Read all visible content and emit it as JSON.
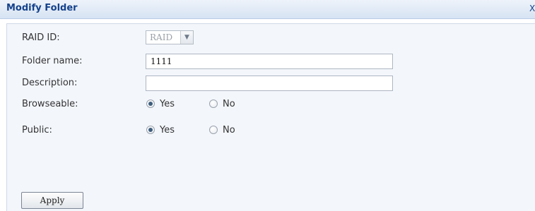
{
  "window": {
    "title": "Modify Folder",
    "close_glyph": "X"
  },
  "form": {
    "raid_id": {
      "label": "RAID ID:",
      "value": "RAID",
      "arrow_icon": "chevron-down-icon",
      "disabled": true
    },
    "folder_name": {
      "label": "Folder name:",
      "value": "1111"
    },
    "description": {
      "label": "Description:",
      "value": ""
    },
    "browseable": {
      "label": "Browseable:",
      "options": [
        "Yes",
        "No"
      ],
      "selected": "Yes"
    },
    "public": {
      "label": "Public:",
      "options": [
        "Yes",
        "No"
      ],
      "selected": "Yes"
    }
  },
  "actions": {
    "apply_label": "Apply"
  },
  "colors": {
    "title_text": "#15428b",
    "panel_bg": "#f3f6fb"
  }
}
